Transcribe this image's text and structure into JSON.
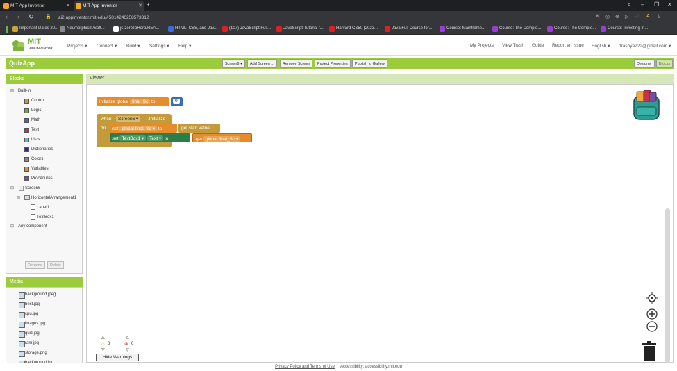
{
  "browser": {
    "tabs": [
      {
        "label": "MIT App Inventor"
      },
      {
        "label": "MIT App Inventor"
      }
    ],
    "url": "ai2.appinventor.mit.edu/#5814246258573312",
    "bookmarks": [
      {
        "label": "Important Dates 20...",
        "color": "#c8a430"
      },
      {
        "label": "Neumorphism/Soft...",
        "color": "#888888"
      },
      {
        "label": "js-zeroToHero/REA...",
        "color": "#ffffff"
      },
      {
        "label": "HTML, CSS, and Jav...",
        "color": "#3b6fd8"
      },
      {
        "label": "(107) JavaScript Full...",
        "color": "#e02020"
      },
      {
        "label": "JavaScript Tutorial f...",
        "color": "#e02020"
      },
      {
        "label": "Harvard CS50 (2023...",
        "color": "#e02020"
      },
      {
        "label": "Java Full Course for...",
        "color": "#e02020"
      },
      {
        "label": "Course: Mainframe...",
        "color": "#9b3dd4"
      },
      {
        "label": "Course: The Comple...",
        "color": "#9b3dd4"
      },
      {
        "label": "Course: The Comple...",
        "color": "#9b3dd4"
      },
      {
        "label": "Course: Investing In...",
        "color": "#9b3dd4"
      }
    ]
  },
  "app": {
    "logo_text": "MIT",
    "logo_sub": "APP INVENTOR",
    "menu_left": [
      "Projects ▾",
      "Connect ▾",
      "Build ▾",
      "Settings ▾",
      "Help ▾"
    ],
    "menu_right": [
      "My Projects",
      "View Trash",
      "Guide",
      "Report an Issue",
      "English ▾",
      "drashya222@gmail.com ▾"
    ],
    "project_name": "QuizApp",
    "toolbar": [
      "Screen6 ▾",
      "Add Screen ...",
      "Remove Screen",
      "Project Properties",
      "Publish to Gallery"
    ],
    "designer_label": "Designer",
    "blocks_label": "Blocks"
  },
  "blocks_panel": {
    "title": "Blocks",
    "builtin": "Built-in",
    "categories": [
      {
        "label": "Control",
        "color": "#c49b3a"
      },
      {
        "label": "Logic",
        "color": "#72a83a"
      },
      {
        "label": "Math",
        "color": "#3a6fb7"
      },
      {
        "label": "Text",
        "color": "#c2334d"
      },
      {
        "label": "Lists",
        "color": "#6cb3d8"
      },
      {
        "label": "Dictionaries",
        "color": "#2d2a8a"
      },
      {
        "label": "Colors",
        "color": "#888888"
      },
      {
        "label": "Variables",
        "color": "#e58c2c"
      },
      {
        "label": "Procedures",
        "color": "#7b4fa0"
      }
    ],
    "screen": "Screen6",
    "arrangement": "HorizontalArrangement1",
    "components": [
      "Label1",
      "TextBox1"
    ],
    "any_component": "Any component",
    "rename": "Rename",
    "delete": "Delete"
  },
  "media_panel": {
    "title": "Media",
    "files": [
      "background.jpeg",
      "best.jpg",
      "cpu.jpg",
      "images.jpg",
      "quiz.jpg",
      "ram.jpg",
      "storage.png",
      "background.jpg"
    ]
  },
  "viewer": {
    "title": "Viewer",
    "b1_initialize": "initialize global",
    "b1_name": "final_Sc",
    "b1_to": "to",
    "b1_value": "0",
    "b2_when": "when",
    "b2_screen": "Screen6 ▾",
    "b2_initialize": ".Initialize",
    "b2_do": "do",
    "b2_set": "set",
    "b2_var": "global final_Sc ▾",
    "b2_to": "to",
    "b2_get_start": "get start value",
    "b3_set": "set",
    "b3_comp": "TextBox1 ▾",
    "b3_prop": "Text ▾",
    "b3_to": "to",
    "b3_get": "get",
    "b3_var": "global final_Sc ▾",
    "warnings_count": "0",
    "errors_count": "0",
    "hide_warnings": "Hide Warnings"
  },
  "footer": {
    "policy": "Privacy Policy and Terms of Use",
    "accessibility": "Accessibility: accessibility.mit.edu"
  }
}
